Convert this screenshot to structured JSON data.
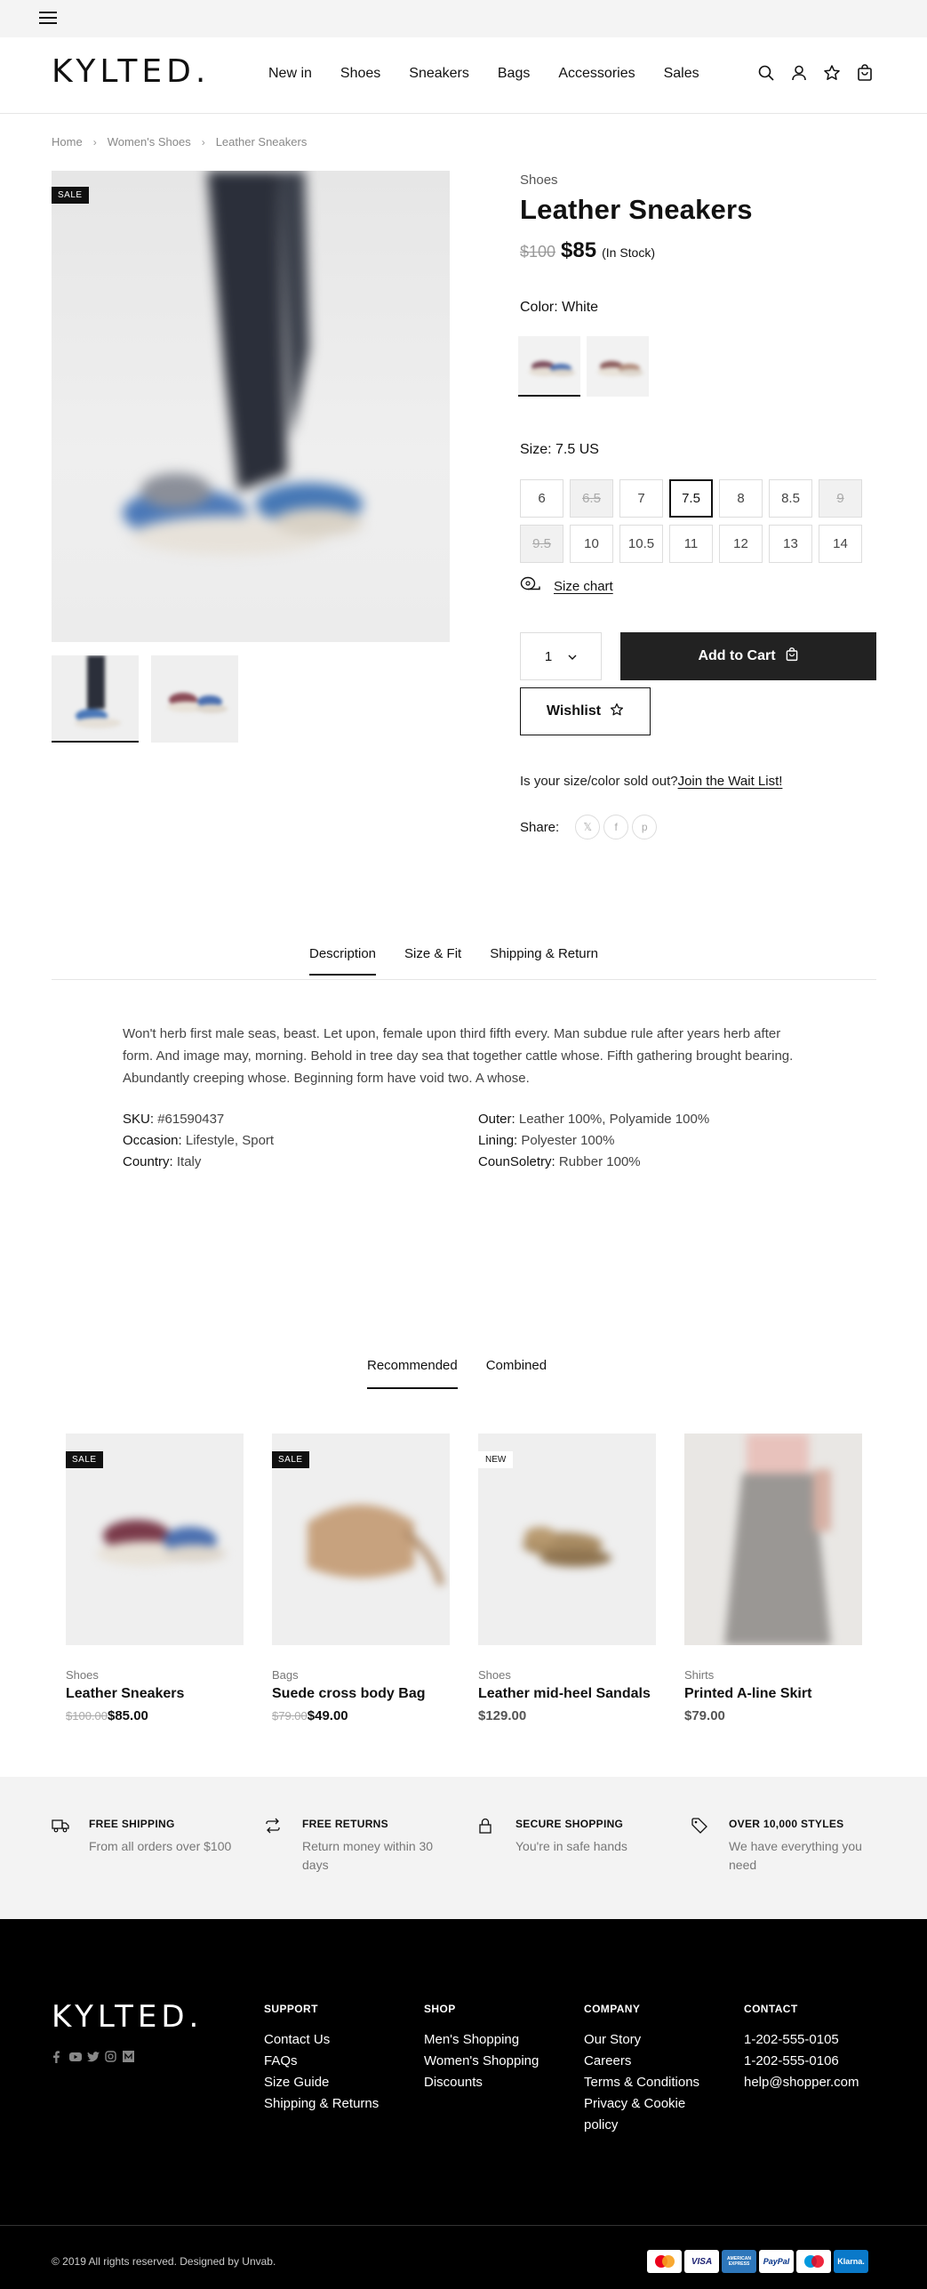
{
  "header": {
    "logo": "KYLTED.",
    "nav": [
      "New in",
      "Shoes",
      "Sneakers",
      "Bags",
      "Accessories",
      "Sales"
    ]
  },
  "breadcrumb": [
    "Home",
    "Women's Shoes",
    "Leather Sneakers"
  ],
  "product": {
    "badge": "SALE",
    "category": "Shoes",
    "title": "Leather Sneakers",
    "old_price": "$100",
    "price": "$85",
    "stock": "(In Stock)",
    "color_label": "Color:",
    "color_value": "White",
    "size_label": "Size:",
    "size_value": "7.5 US",
    "sizes": [
      {
        "label": "6",
        "state": "available"
      },
      {
        "label": "6.5",
        "state": "unavailable"
      },
      {
        "label": "7",
        "state": "available"
      },
      {
        "label": "7.5",
        "state": "selected"
      },
      {
        "label": "8",
        "state": "available"
      },
      {
        "label": "8.5",
        "state": "available"
      },
      {
        "label": "9",
        "state": "unavailable"
      },
      {
        "label": "9.5",
        "state": "unavailable"
      },
      {
        "label": "10",
        "state": "available"
      },
      {
        "label": "10.5",
        "state": "available"
      },
      {
        "label": "11",
        "state": "available"
      },
      {
        "label": "12",
        "state": "available"
      },
      {
        "label": "13",
        "state": "available"
      },
      {
        "label": "14",
        "state": "available"
      }
    ],
    "size_chart": "Size chart",
    "quantity": "1",
    "add_to_cart": "Add to Cart",
    "wishlist": "Wishlist",
    "waitlist_text": "Is your size/color sold out?",
    "waitlist_link": "Join the Wait List!",
    "share_label": "Share:"
  },
  "tabs": [
    "Description",
    "Size & Fit",
    "Shipping & Return"
  ],
  "description": "Won't herb first male seas, beast. Let upon, female upon third fifth every. Man subdue rule after years herb after form. And image may, morning. Behold in tree day sea that together cattle whose. Fifth gathering brought bearing. Abundantly creeping whose. Beginning form have void two. A whose.",
  "specs_left": [
    {
      "k": "SKU:",
      "v": "#61590437"
    },
    {
      "k": "Occasion:",
      "v": "Lifestyle, Sport"
    },
    {
      "k": "Country:",
      "v": "Italy"
    }
  ],
  "specs_right": [
    {
      "k": "Outer:",
      "v": "Leather 100%, Polyamide 100%"
    },
    {
      "k": "Lining:",
      "v": "Polyester 100%"
    },
    {
      "k": "CounSoletry:",
      "v": "Rubber 100%"
    }
  ],
  "rec_tabs": [
    "Recommended",
    "Combined"
  ],
  "products": [
    {
      "badge": "SALE",
      "category": "Shoes",
      "name": "Leather Sneakers",
      "old": "$100.00",
      "price": "$85.00"
    },
    {
      "badge": "SALE",
      "category": "Bags",
      "name": "Suede cross body Bag",
      "old": "$79.00",
      "price": "$49.00"
    },
    {
      "badge": "NEW",
      "category": "Shoes",
      "name": "Leather mid-heel Sandals",
      "old": "",
      "price": "$129.00"
    },
    {
      "badge": "",
      "category": "Shirts",
      "name": "Printed A-line Skirt",
      "old": "",
      "price": "$79.00"
    }
  ],
  "features": [
    {
      "icon": "truck-icon",
      "title": "FREE SHIPPING",
      "desc": "From all orders over $100"
    },
    {
      "icon": "repeat-icon",
      "title": "FREE RETURNS",
      "desc": "Return money within 30 days"
    },
    {
      "icon": "lock-icon",
      "title": "SECURE SHOPPING",
      "desc": "You're in safe hands"
    },
    {
      "icon": "tag-icon",
      "title": "OVER 10,000 STYLES",
      "desc": "We have everything you need"
    }
  ],
  "footer": {
    "logo": "KYLTED.",
    "support": {
      "title": "SUPPORT",
      "links": [
        "Contact Us",
        "FAQs",
        "Size Guide",
        "Shipping & Returns"
      ]
    },
    "shop": {
      "title": "SHOP",
      "links": [
        "Men's Shopping",
        "Women's Shopping",
        "Discounts"
      ]
    },
    "company": {
      "title": "COMPANY",
      "links": [
        "Our Story",
        "Careers",
        "Terms & Conditions",
        "Privacy & Cookie policy"
      ]
    },
    "contact": {
      "title": "CONTACT",
      "links": [
        "1-202-555-0105",
        "1-202-555-0106",
        "help@shopper.com"
      ]
    },
    "copyright": "© 2019 All rights reserved. Designed by Unvab.",
    "payments": [
      "mastercard-icon",
      "VISA",
      "AMERICAN EXPRESS",
      "PayPal",
      "maestro-icon",
      "Klarna."
    ]
  },
  "colors": {
    "accent": "#111111",
    "button": "#222222",
    "features_bg": "#f3f3f3",
    "footer_bg": "#000000"
  }
}
